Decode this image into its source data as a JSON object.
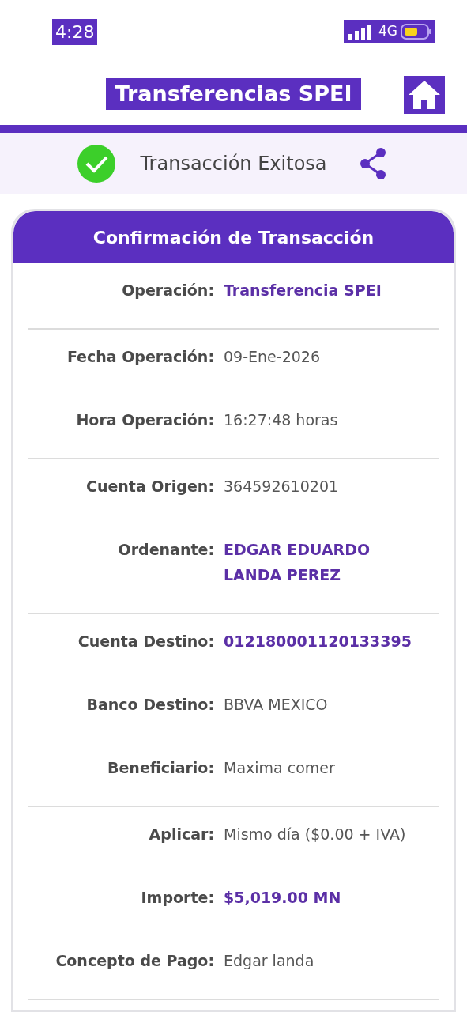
{
  "status_bar": {
    "time": "4:28",
    "network": "4G"
  },
  "header": {
    "title": "Transferencias SPEI"
  },
  "result": {
    "message": "Transacción Exitosa"
  },
  "card": {
    "title": "Confirmación de Transacción",
    "groups": [
      {
        "rows": [
          {
            "label": "Operación:",
            "value": "Transferencia SPEI",
            "highlight": true
          }
        ]
      },
      {
        "rows": [
          {
            "label": "Fecha Operación:",
            "value": "09-Ene-2026",
            "highlight": false
          },
          {
            "label": "Hora Operación:",
            "value": "16:27:48 horas",
            "highlight": false
          }
        ]
      },
      {
        "rows": [
          {
            "label": "Cuenta Origen:",
            "value": "364592610201",
            "highlight": false
          },
          {
            "label": "Ordenante:",
            "value": "EDGAR EDUARDO LANDA PEREZ",
            "highlight": true
          }
        ]
      },
      {
        "rows": [
          {
            "label": "Cuenta Destino:",
            "value": "012180001120133395",
            "highlight": true
          },
          {
            "label": "Banco Destino:",
            "value": "BBVA MEXICO",
            "highlight": false
          },
          {
            "label": "Beneficiario:",
            "value": "Maxima comer",
            "highlight": false
          }
        ]
      },
      {
        "rows": [
          {
            "label": "Aplicar:",
            "value": "Mismo día ($0.00 + IVA)",
            "highlight": false
          },
          {
            "label": "Importe:",
            "value": "$5,019.00 MN",
            "highlight": true
          },
          {
            "label": "Concepto de Pago:",
            "value": "Edgar landa",
            "highlight": false
          }
        ]
      }
    ]
  }
}
